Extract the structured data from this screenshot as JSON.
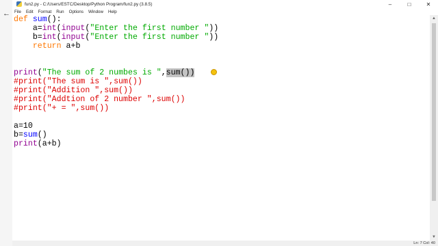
{
  "window": {
    "title": "fun2.py - C:/Users/ESTC/Desktop/Python Program/fun2.py (3.8.5)",
    "minimize_glyph": "–",
    "maximize_glyph": "□",
    "close_glyph": "✕"
  },
  "nav": {
    "back_glyph": "←"
  },
  "menu": {
    "items": [
      "File",
      "Edit",
      "Format",
      "Run",
      "Options",
      "Window",
      "Help"
    ]
  },
  "editor": {
    "lines": [
      {
        "tokens": [
          {
            "t": "def ",
            "c": "kw"
          },
          {
            "t": "sum",
            "c": "fn"
          },
          {
            "t": "():",
            "c": ""
          }
        ]
      },
      {
        "tokens": [
          {
            "t": "    a=",
            "c": ""
          },
          {
            "t": "int",
            "c": "bi"
          },
          {
            "t": "(",
            "c": ""
          },
          {
            "t": "input",
            "c": "bi"
          },
          {
            "t": "(",
            "c": ""
          },
          {
            "t": "\"Enter the first number \"",
            "c": "str"
          },
          {
            "t": "))",
            "c": ""
          }
        ]
      },
      {
        "tokens": [
          {
            "t": "    b=",
            "c": ""
          },
          {
            "t": "int",
            "c": "bi"
          },
          {
            "t": "(",
            "c": ""
          },
          {
            "t": "input",
            "c": "bi"
          },
          {
            "t": "(",
            "c": ""
          },
          {
            "t": "\"Enter the first number \"",
            "c": "str"
          },
          {
            "t": "))",
            "c": ""
          }
        ]
      },
      {
        "tokens": [
          {
            "t": "    ",
            "c": ""
          },
          {
            "t": "return",
            "c": "kw"
          },
          {
            "t": " a+b",
            "c": ""
          }
        ]
      },
      {
        "tokens": []
      },
      {
        "tokens": []
      },
      {
        "tokens": [
          {
            "t": "print",
            "c": "bi"
          },
          {
            "t": "(",
            "c": ""
          },
          {
            "t": "\"The sum of 2 numbes is \"",
            "c": "str"
          },
          {
            "t": ",",
            "c": ""
          },
          {
            "t": "sum()",
            "c": "sel"
          },
          {
            "t": ")",
            "c": "sel"
          }
        ]
      },
      {
        "tokens": [
          {
            "t": "#print(\"The sum is \",sum())",
            "c": "cm"
          }
        ]
      },
      {
        "tokens": [
          {
            "t": "#print(\"Addition \",sum())",
            "c": "cm"
          }
        ]
      },
      {
        "tokens": [
          {
            "t": "#print(\"Addtion of 2 number \",sum())",
            "c": "cm"
          }
        ]
      },
      {
        "tokens": [
          {
            "t": "#print(\"+ = \",sum())",
            "c": "cm"
          }
        ]
      },
      {
        "tokens": []
      },
      {
        "tokens": [
          {
            "t": "a=10",
            "c": ""
          }
        ]
      },
      {
        "tokens": [
          {
            "t": "b=",
            "c": ""
          },
          {
            "t": "sum",
            "c": "fn"
          },
          {
            "t": "()",
            "c": ""
          }
        ]
      },
      {
        "tokens": [
          {
            "t": "print",
            "c": "bi"
          },
          {
            "t": "(a+b)",
            "c": ""
          }
        ]
      }
    ]
  },
  "status": {
    "position": "Ln: 7 Col: 40"
  },
  "colors": {
    "keyword": "#ff7700",
    "function_name": "#0000ff",
    "builtin": "#900090",
    "string": "#00aa00",
    "comment": "#dd0000",
    "selection": "#c3c3c3"
  }
}
